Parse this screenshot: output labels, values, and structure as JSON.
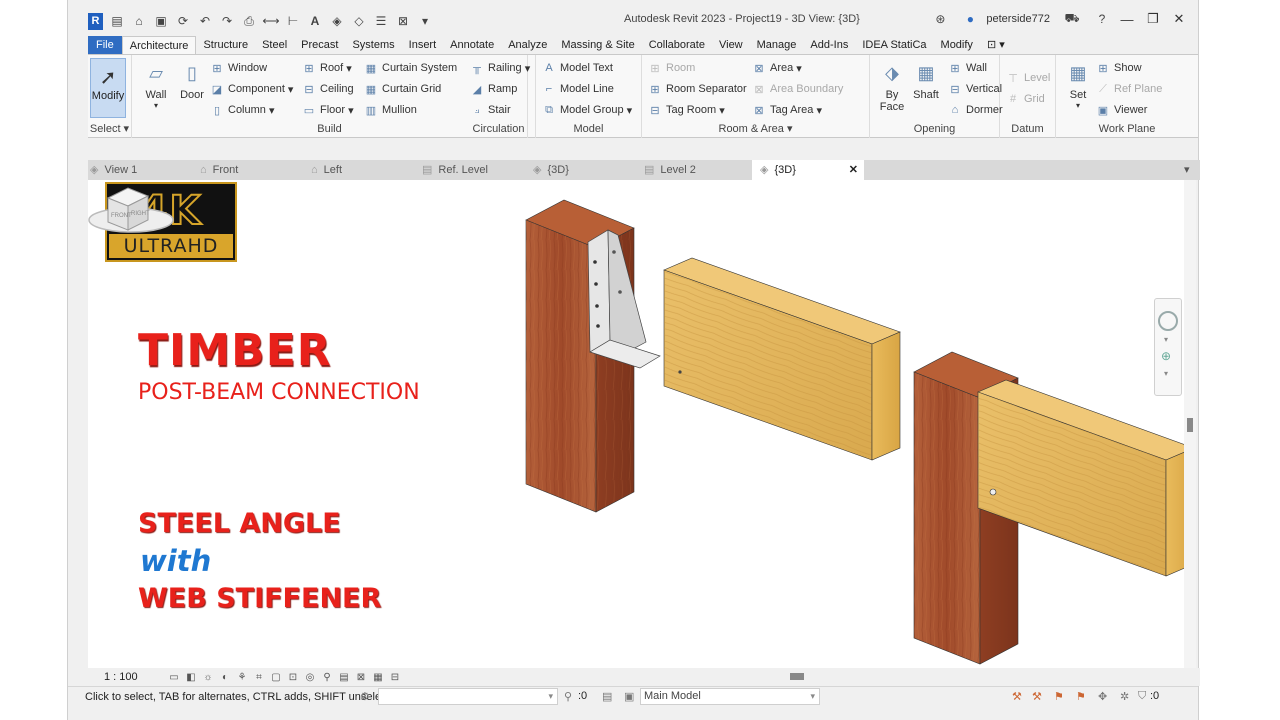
{
  "window": {
    "title": "Autodesk Revit 2023 - Project19 - 3D View: {3D}",
    "user": "peterside772",
    "app_icon": "R"
  },
  "tabs": [
    "File",
    "Architecture",
    "Structure",
    "Steel",
    "Precast",
    "Systems",
    "Insert",
    "Annotate",
    "Analyze",
    "Massing & Site",
    "Collaborate",
    "View",
    "Manage",
    "Add-Ins",
    "IDEA StatiCa",
    "Modify"
  ],
  "ribbon": {
    "select": {
      "modify": "Modify",
      "title": "Select"
    },
    "build": {
      "title": "Build",
      "wall": "Wall",
      "door": "Door",
      "window": "Window",
      "component": "Component",
      "column": "Column",
      "roof": "Roof",
      "ceiling": "Ceiling",
      "floor": "Floor",
      "curtain_system": "Curtain  System",
      "curtain_grid": "Curtain  Grid",
      "mullion": "Mullion"
    },
    "circulation": {
      "title": "Circulation",
      "railing": "Railing",
      "ramp": "Ramp",
      "stair": "Stair"
    },
    "model": {
      "title": "Model",
      "text": "Model  Text",
      "line": "Model  Line",
      "group": "Model  Group"
    },
    "room_area": {
      "title": "Room & Area",
      "room": "Room",
      "room_separator": "Room  Separator",
      "tag_room": "Tag  Room",
      "area": "Area",
      "area_boundary": "Area  Boundary",
      "tag_area": "Tag  Area"
    },
    "opening": {
      "title": "Opening",
      "by_face_1": "By",
      "by_face_2": "Face",
      "shaft": "Shaft",
      "wall": "Wall",
      "vertical": "Vertical",
      "dormer": "Dormer"
    },
    "datum": {
      "title": "Datum",
      "level": "Level",
      "grid": "Grid"
    },
    "work_plane": {
      "title": "Work Plane",
      "set": "Set",
      "show": "Show",
      "ref_plane": "Ref  Plane",
      "viewer": "Viewer"
    }
  },
  "view_tabs": [
    {
      "label": "View 1",
      "icon": "3d-view-icon"
    },
    {
      "label": "Front",
      "icon": "elevation-icon"
    },
    {
      "label": "Left",
      "icon": "elevation-icon"
    },
    {
      "label": "Ref. Level",
      "icon": "plan-icon"
    },
    {
      "label": "{3D}",
      "icon": "3d-view-icon"
    },
    {
      "label": "Level 2",
      "icon": "plan-icon"
    },
    {
      "label": "{3D}",
      "icon": "3d-view-icon",
      "active": true
    }
  ],
  "overlay": {
    "badge_top": "4K",
    "badge_bottom": "ULTRAHD",
    "title": "TIMBER",
    "subtitle": "POST-BEAM CONNECTION",
    "line1": "STEEL ANGLE",
    "line2": "with",
    "line3": "WEB STIFFENER"
  },
  "viewcube": {
    "front": "FRONT",
    "right": "RIGHT"
  },
  "view_control": {
    "scale": "1 : 100"
  },
  "status": {
    "hint": "Click to select, TAB for alternates, CTRL adds, SHIFT unselect",
    "count1": ":0",
    "count2": ":0",
    "model": "Main Model",
    "filter_count": ":0"
  },
  "colors": {
    "file_tab": "#2f6cc2",
    "title_red": "#e8211b",
    "with_blue": "#1f78d1",
    "badge_gold": "#d9a52b",
    "post_wood": "#a9502e",
    "beam_wood": "#e2b45c",
    "steel": "#d9d9d9"
  }
}
